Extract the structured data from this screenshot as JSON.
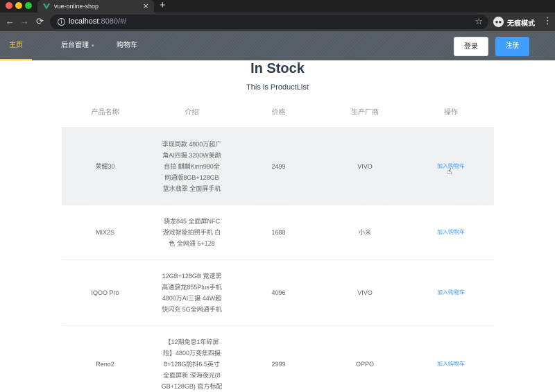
{
  "browser": {
    "tab_title": "vue-online-shop",
    "tab_close": "×",
    "new_tab": "+",
    "url_host": "localhost",
    "url_rest": ":8080/#/",
    "incognito_label": "无痕模式",
    "back": "←",
    "forward": "→",
    "reload": "⟳",
    "bookmark": "☆",
    "menu": "⋮",
    "info": "i"
  },
  "nav": {
    "home": "主页",
    "admin": "后台管理",
    "admin_caret": "▾",
    "cart": "购物车",
    "login": "登录",
    "register": "注册"
  },
  "page": {
    "title": "In Stock",
    "subtitle": "This is ProductList"
  },
  "table": {
    "headers": [
      "产品名称",
      "介绍",
      "价格",
      "生产厂商",
      "操作"
    ],
    "rows": [
      {
        "name": "荣耀30",
        "desc": "李现同款 4800万超广角AI四摄 3200W美颜自拍 麒麟Kirin980全网通版8GB+128GB 蓝水翡翠 全面屏手机",
        "price": "2499",
        "maker": "VIVO",
        "action": "加入购物车"
      },
      {
        "name": "MIX2S",
        "desc": "骁龙845 全面屏NFC 游戏智能拍照手机 白色 全网通 6+128",
        "price": "1688",
        "maker": "小米",
        "action": "加入购物车"
      },
      {
        "name": "IQOO Pro",
        "desc": "12GB+128GB 竞速黑 高通骁龙855Plus手机 4800万AI三摄 44W超快闪充 5G全网通手机",
        "price": "4096",
        "maker": "VIVO",
        "action": "加入购物车"
      },
      {
        "name": "Reno2",
        "desc": "【12期免息1年碎屏险】4800万变焦四摄8+128G防抖6.5英寸全面屏新 深海夜光(8GB+128GB) 官方标配",
        "price": "2999",
        "maker": "OPPO",
        "action": "加入购物车"
      }
    ]
  },
  "colors": {
    "accent": "#409eff",
    "menu_active": "#ffd04b",
    "header_bg": "#545c64"
  }
}
